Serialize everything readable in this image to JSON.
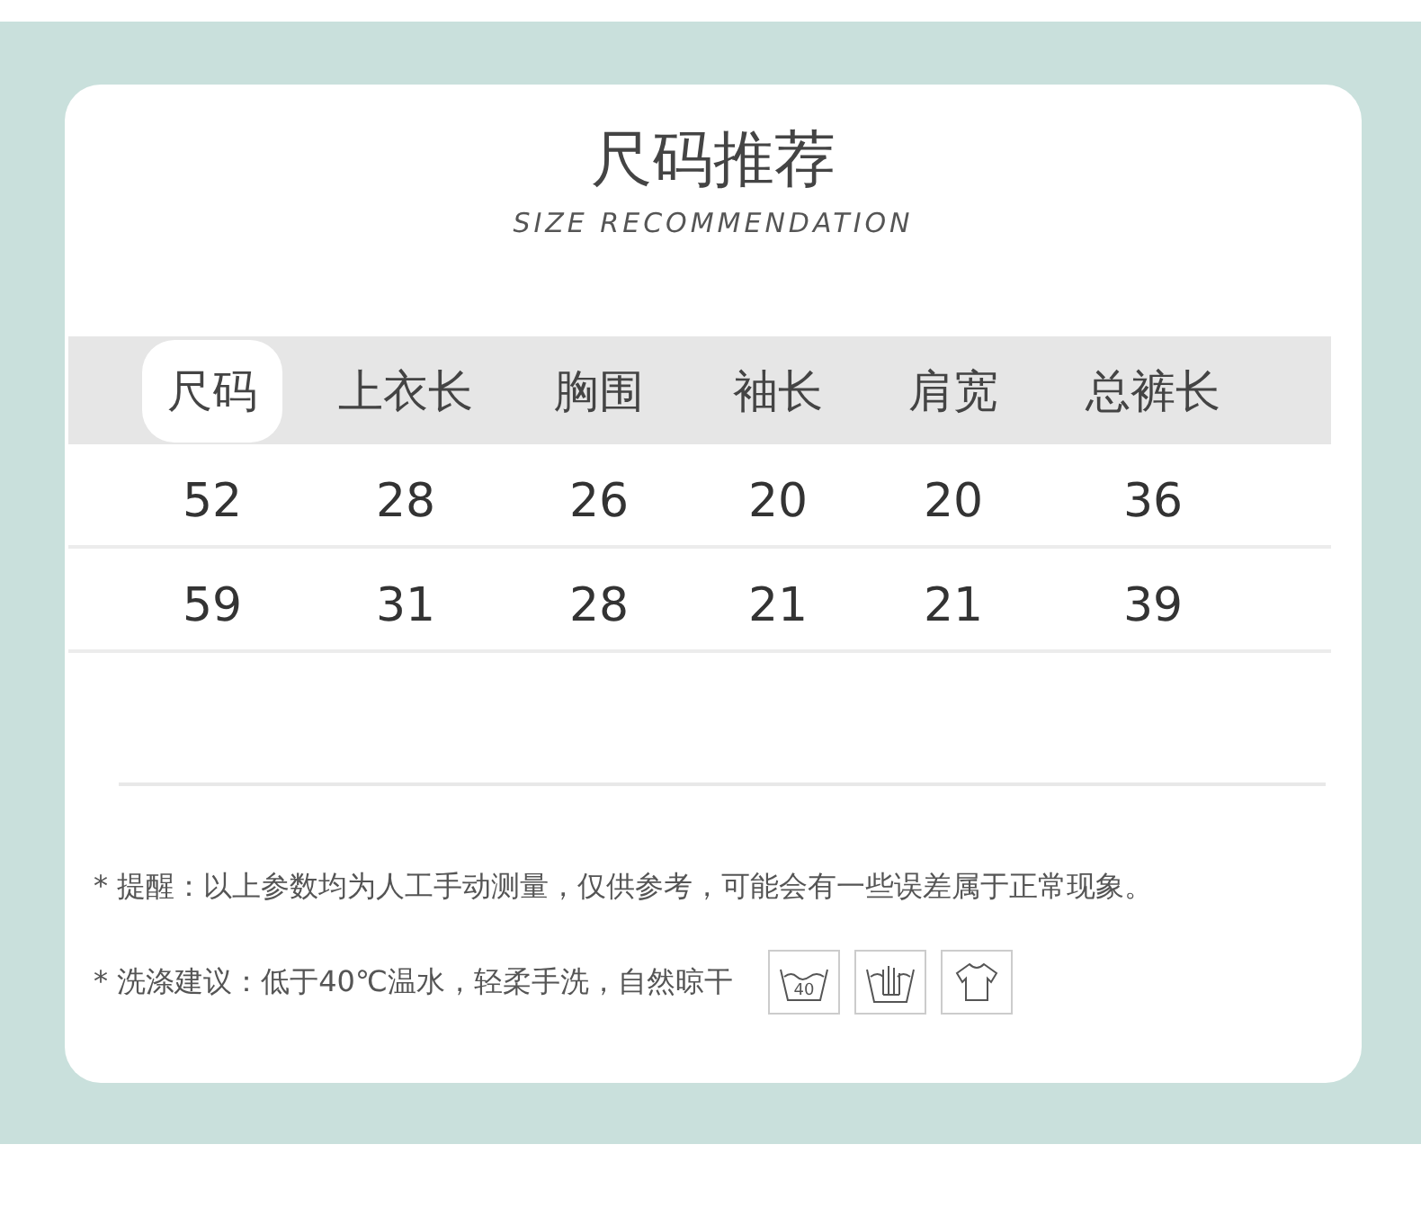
{
  "title": "尺码推荐",
  "subtitle": "SIZE RECOMMENDATION",
  "columns": [
    {
      "label": "尺码",
      "selected": true
    },
    {
      "label": "上衣长",
      "selected": false
    },
    {
      "label": "胸围",
      "selected": false
    },
    {
      "label": "袖长",
      "selected": false
    },
    {
      "label": "肩宽",
      "selected": false
    },
    {
      "label": "总裤长",
      "selected": false
    }
  ],
  "rows": [
    [
      "52",
      "28",
      "26",
      "20",
      "20",
      "36"
    ],
    [
      "59",
      "31",
      "28",
      "21",
      "21",
      "39"
    ]
  ],
  "notes": [
    {
      "text": "* 提醒：以上参数均为人工手动测量，仅供参考，可能会有一些误差属于正常现象。"
    },
    {
      "text": "* 洗涤建议：低于40℃温水，轻柔手洗，自然晾干",
      "icons": [
        {
          "kind": "wash",
          "label": "40"
        },
        {
          "kind": "handwash"
        },
        {
          "kind": "shirt"
        }
      ]
    }
  ]
}
